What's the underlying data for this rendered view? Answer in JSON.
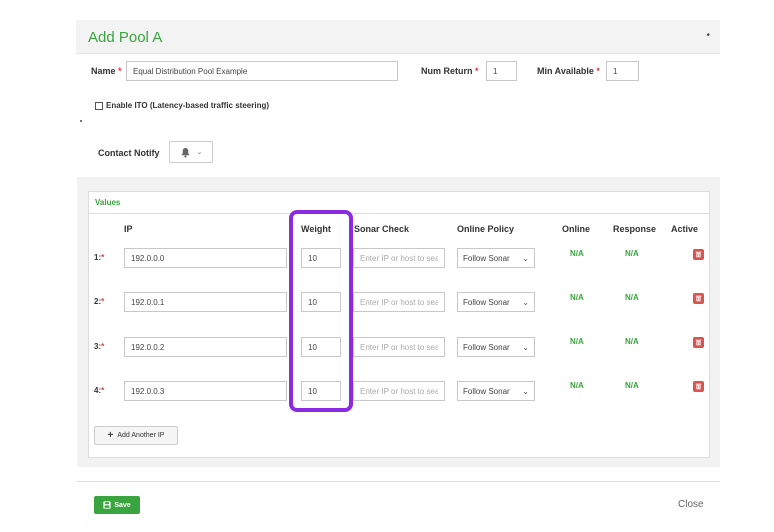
{
  "modal": {
    "title": "Add Pool A",
    "header_mark": "•"
  },
  "form": {
    "name_label": "Name",
    "name_value": "Equal Distribution Pool Example",
    "num_return_label": "Num Return",
    "num_return_value": "1",
    "min_available_label": "Min Available",
    "min_available_value": "1",
    "required_mark": "*",
    "ito_label": "Enable ITO (Latency-based traffic steering)",
    "contact_notify_label": "Contact Notify",
    "bell_icon": "bell-icon"
  },
  "values": {
    "title": "Values",
    "columns": {
      "ip": "IP",
      "weight": "Weight",
      "sonar": "Sonar Check",
      "policy": "Online Policy",
      "online": "Online",
      "response": "Response",
      "active": "Active"
    },
    "sonar_placeholder": "Enter IP or host to search",
    "rows": [
      {
        "num": "1:",
        "ip": "192.0.0.0",
        "weight": "10",
        "policy": "Follow Sonar",
        "online": "N/A",
        "response": "N/A"
      },
      {
        "num": "2:",
        "ip": "192.0.0.1",
        "weight": "10",
        "policy": "Follow Sonar",
        "online": "N/A",
        "response": "N/A"
      },
      {
        "num": "3:",
        "ip": "192.0.0.2",
        "weight": "10",
        "policy": "Follow Sonar",
        "online": "N/A",
        "response": "N/A"
      },
      {
        "num": "4:",
        "ip": "192.0.0.3",
        "weight": "10",
        "policy": "Follow Sonar",
        "online": "N/A",
        "response": "N/A"
      }
    ],
    "add_button_label": "Add Another IP"
  },
  "footer": {
    "save_label": "Save",
    "close_label": "Close"
  },
  "colors": {
    "accent": "#3aa53f",
    "required": "#e0383e",
    "delete": "#d9534f",
    "highlight": "#8a2be2"
  }
}
